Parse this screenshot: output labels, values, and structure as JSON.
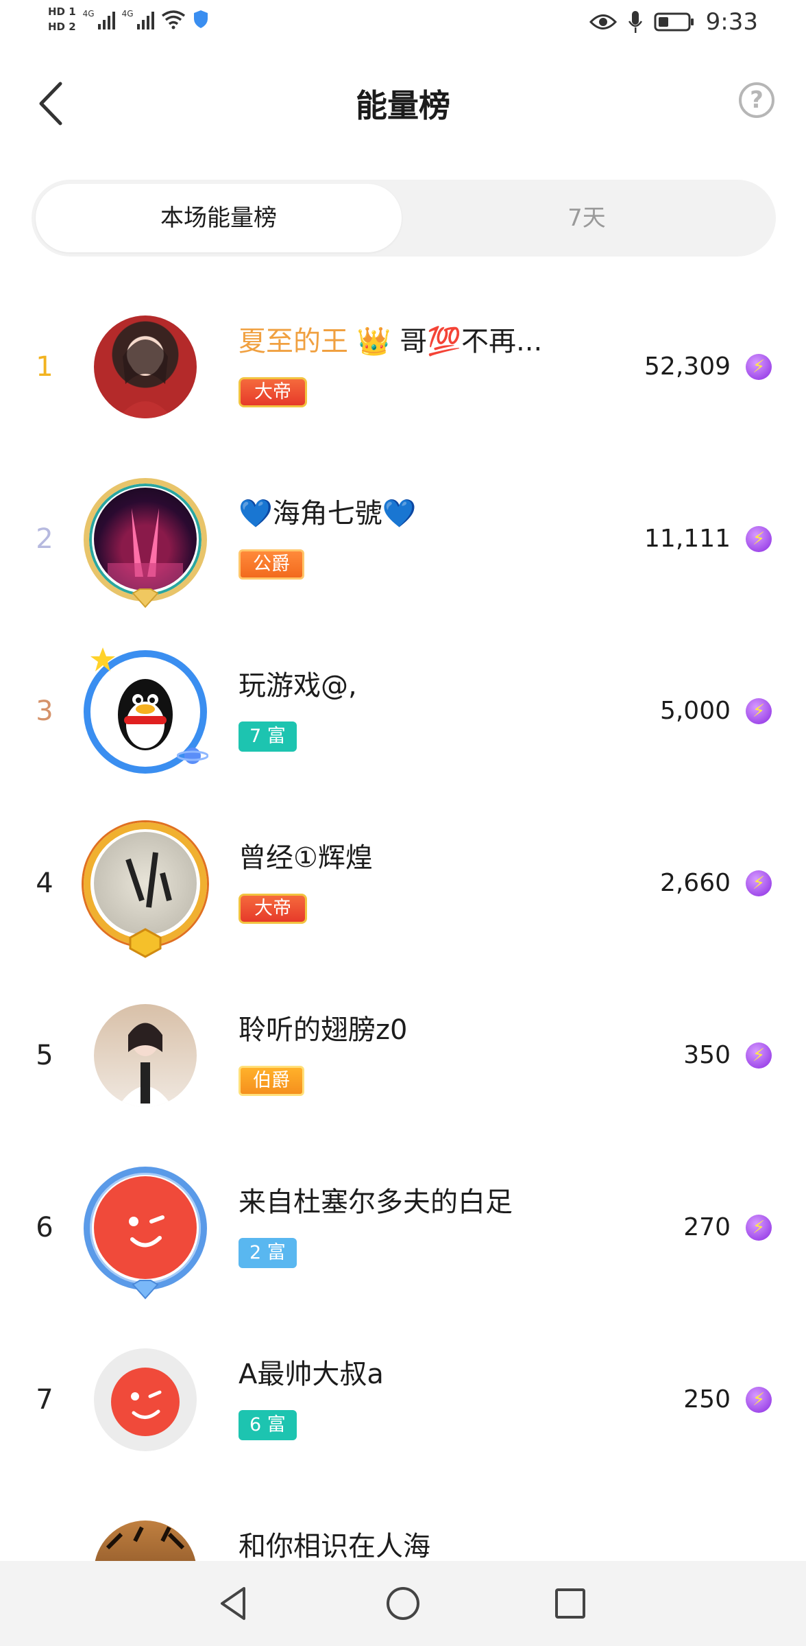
{
  "status_bar": {
    "hd1": "HD 1",
    "hd2": "HD 2",
    "net1": "4G",
    "net2": "4G",
    "time": "9:33"
  },
  "header": {
    "title": "能量榜",
    "help": "?"
  },
  "tabs": [
    {
      "label": "本场能量榜",
      "active": true
    },
    {
      "label": "7天",
      "active": false
    }
  ],
  "ranking": [
    {
      "rank": "1",
      "name_highlight": "夏至的王 👑",
      "name": " 哥💯不再...",
      "badge": "大帝",
      "badge_type": "emperor",
      "score": "52,309"
    },
    {
      "rank": "2",
      "name_highlight": "",
      "name": "💙海角七號💙",
      "badge": "公爵",
      "badge_type": "duke",
      "score": "11,111"
    },
    {
      "rank": "3",
      "name_highlight": "",
      "name": "玩游戏@,",
      "badge": "7 富",
      "badge_type": "rich-teal",
      "score": "5,000"
    },
    {
      "rank": "4",
      "name_highlight": "",
      "name": "曾经①辉煌",
      "badge": "大帝",
      "badge_type": "emperor",
      "score": "2,660"
    },
    {
      "rank": "5",
      "name_highlight": "",
      "name": "聆听的翅膀z0",
      "badge": "伯爵",
      "badge_type": "earl",
      "score": "350"
    },
    {
      "rank": "6",
      "name_highlight": "",
      "name": "来自杜塞尔多夫的白足",
      "badge": "2 富",
      "badge_type": "rich-blue",
      "score": "270"
    },
    {
      "rank": "7",
      "name_highlight": "",
      "name": "A最帅大叔a",
      "badge": "6 富",
      "badge_type": "rich-teal",
      "score": "250"
    },
    {
      "rank": "",
      "name_highlight": "",
      "name": "和你相识在人海",
      "badge": "",
      "badge_type": "",
      "score": ""
    }
  ],
  "colors": {
    "rank1": "#f2b320",
    "rank2": "#b6b9df",
    "rank3": "#d5926a",
    "highlight_name": "#f0a040",
    "energy": "#8a2be2"
  }
}
